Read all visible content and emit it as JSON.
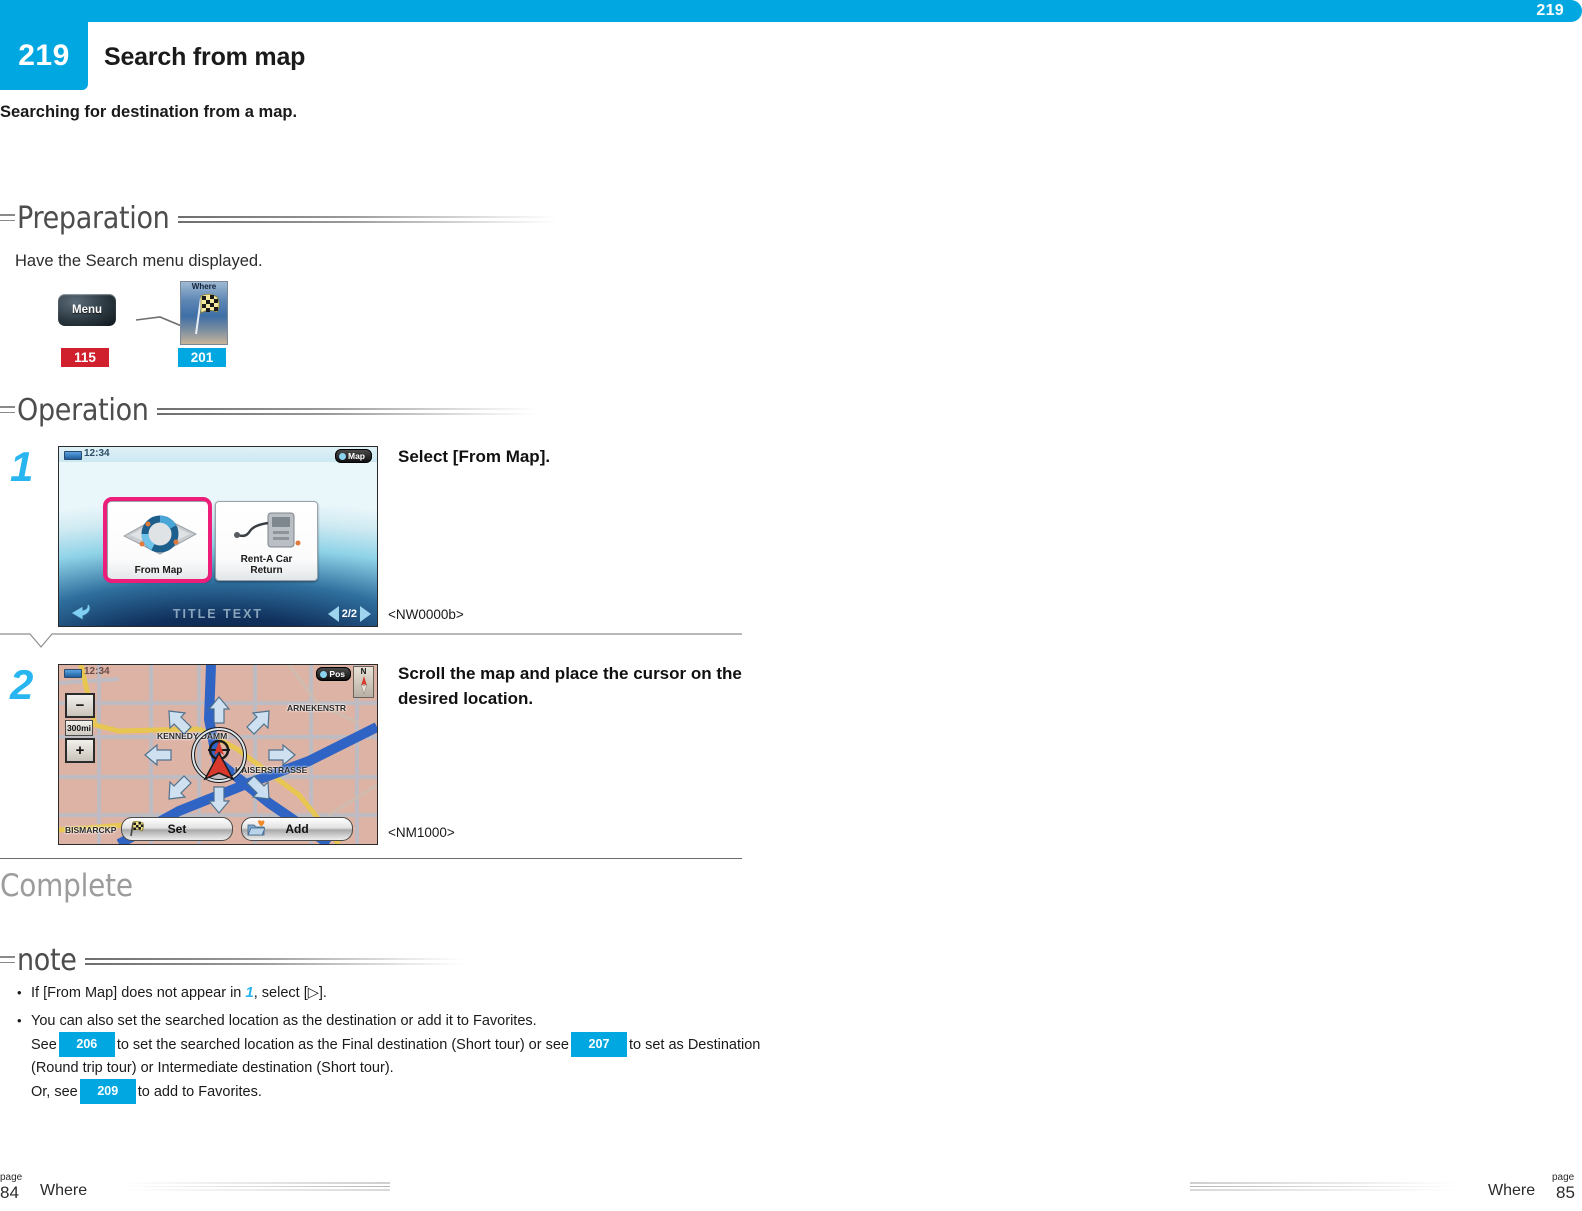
{
  "header": {
    "corner_number": "219",
    "badge_number": "219",
    "title": "Search from map",
    "subtitle": "Searching for destination from a map."
  },
  "sections": {
    "preparation": {
      "label": "Preparation",
      "text": "Have the Search menu displayed."
    },
    "operation": {
      "label": "Operation"
    },
    "complete": {
      "label": "Complete"
    },
    "note": {
      "label": "note"
    }
  },
  "preparation_icons": {
    "menu_button_label": "Menu",
    "menu_badge": "115",
    "where_icon_label": "Where",
    "where_badge": "201",
    "arrow_icon": "arrow-line-icon"
  },
  "steps": [
    {
      "number": "1",
      "instruction": "Select [From Map].",
      "code": "<NW0000b>",
      "screen": {
        "clock": "12:34",
        "map_button": "Map",
        "tiles": [
          {
            "label": "From Map",
            "highlighted": true
          },
          {
            "label": "Rent-A Car\nReturn",
            "highlighted": false
          }
        ],
        "tile1_label": "From Map",
        "tile2_label_line1": "Rent-A Car",
        "tile2_label_line2": "Return",
        "title_text": "TITLE TEXT",
        "page_indicator": "2/2"
      }
    },
    {
      "number": "2",
      "instruction": "Scroll the map and place the cursor on the desired location.",
      "code": "<NM1000>",
      "screen": {
        "clock": "12:34",
        "pos_button": "Pos",
        "compass": "N",
        "zoom_out": "−",
        "zoom_in": "+",
        "scale": "300mi",
        "set_button": "Set",
        "add_button": "Add",
        "streets": [
          "KENNEDY DAMM",
          "ARNEKENSTR",
          "KAISERSTRASSE",
          "BISMARCKP"
        ],
        "street_kennedy": "KENNEDY DAMM",
        "street_arneken": "ARNEKENSTR",
        "street_kaiser": "KAISERSTRASSE",
        "street_bismarck": "BISMARCKP"
      }
    }
  ],
  "notes": [
    {
      "prefix": "If [From Map] does not appear in ",
      "step_ref": "1",
      "suffix": ", select [▷]."
    }
  ],
  "note2": {
    "line1": "You can also set the searched location as the destination or add it to Favorites.",
    "line2_a": "See",
    "badge_206": "206",
    "line2_b": "to set the searched location as the Final destination (Short tour) or see",
    "badge_207": "207",
    "line2_c": "to set as Destination",
    "line3": "(Round trip tour) or Intermediate destination (Short tour).",
    "line4_a": "Or, see",
    "badge_209": "209",
    "line4_b": "to add to Favorites."
  },
  "footer": {
    "left_page_label": "page",
    "left_page_number": "84",
    "left_section": "Where",
    "right_section": "Where",
    "right_page_label": "page",
    "right_page_number": "85"
  },
  "colors": {
    "accent_blue": "#00a7e1",
    "step_blue": "#29b6f0",
    "badge_red": "#d0202e",
    "highlight_pink": "#ec1e79"
  }
}
